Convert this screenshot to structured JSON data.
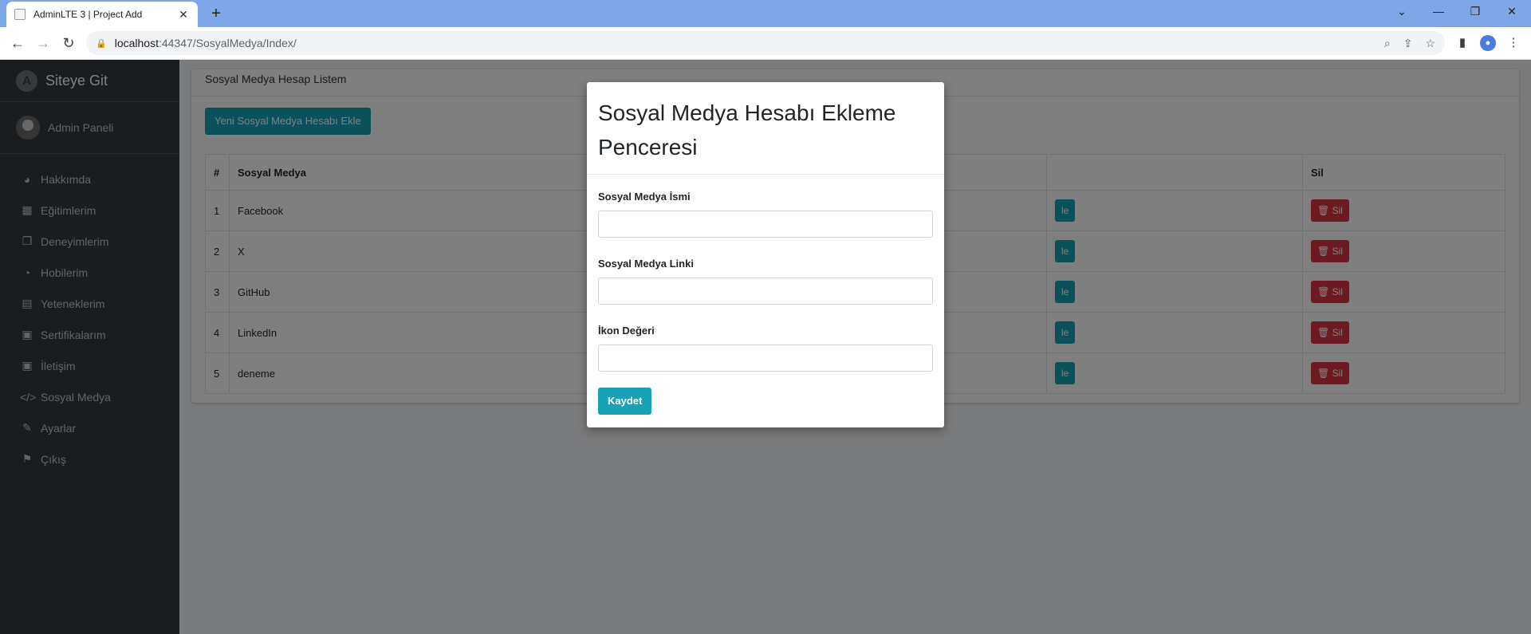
{
  "browser": {
    "tab_title": "AdminLTE 3 | Project Add",
    "tab_close": "✕",
    "new_tab": "+",
    "url_host": "localhost",
    "url_rest": ":44347/SosyalMedya/Index/"
  },
  "sidebar": {
    "brand": "Siteye Git",
    "user": "Admin Paneli",
    "items": [
      {
        "label": "Hakkımda",
        "icon": "dashboard-icon"
      },
      {
        "label": "Eğitimlerim",
        "icon": "grid-icon"
      },
      {
        "label": "Deneyimlerim",
        "icon": "copy-icon"
      },
      {
        "label": "Hobilerim",
        "icon": "pie-chart-icon"
      },
      {
        "label": "Yeteneklerim",
        "icon": "calendar-icon"
      },
      {
        "label": "Sertifikalarım",
        "icon": "image-icon"
      },
      {
        "label": "İletişim",
        "icon": "image-icon"
      },
      {
        "label": "Sosyal Medya",
        "icon": "code-icon"
      },
      {
        "label": "Ayarlar",
        "icon": "pencil-icon"
      },
      {
        "label": "Çıkış",
        "icon": "flag-icon"
      }
    ]
  },
  "main": {
    "header": "Sosyal Medya Hesap Listem",
    "add_button": "Yeni Sosyal Medya Hesabı Ekle",
    "table": {
      "headers": [
        "#",
        "Sosyal Medya",
        "Sil"
      ],
      "edit_label_fragment": "le",
      "delete_label": "Sil",
      "rows": [
        {
          "id": "1",
          "name": "Facebook"
        },
        {
          "id": "2",
          "name": "X"
        },
        {
          "id": "3",
          "name": "GitHub"
        },
        {
          "id": "4",
          "name": "LinkedIn"
        },
        {
          "id": "5",
          "name": "deneme"
        }
      ]
    }
  },
  "modal": {
    "title": "Sosyal Medya Hesabı Ekleme Penceresi",
    "fields": [
      {
        "label": "Sosyal Medya İsmi",
        "value": ""
      },
      {
        "label": "Sosyal Medya Linki",
        "value": ""
      },
      {
        "label": "İkon Değeri",
        "value": ""
      }
    ],
    "save": "Kaydet"
  },
  "colors": {
    "sidebar": "#343a40",
    "primary": "#17a2b8",
    "danger": "#dc3545",
    "browser_frame": "#7ea7e8"
  }
}
